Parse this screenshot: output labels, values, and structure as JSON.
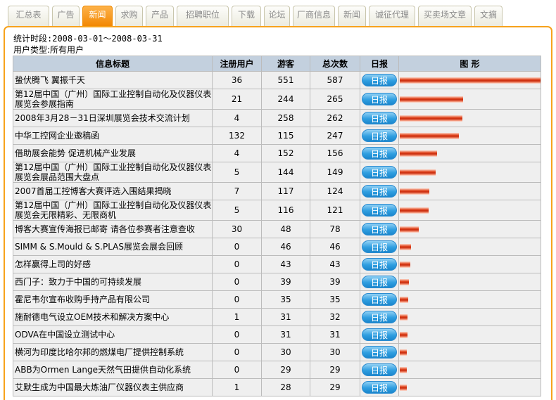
{
  "tabs": [
    {
      "label": "汇总表",
      "active": false
    },
    {
      "label": "广告",
      "active": false
    },
    {
      "label": "新闻",
      "active": true
    },
    {
      "label": "求购",
      "active": false
    },
    {
      "label": "产品",
      "active": false
    },
    {
      "label": "招聘职位",
      "active": false
    },
    {
      "label": "下载",
      "active": false
    },
    {
      "label": "论坛",
      "active": false
    },
    {
      "label": "厂商信息",
      "active": false
    },
    {
      "label": "新闻",
      "active": false
    },
    {
      "label": "诚征代理",
      "active": false
    },
    {
      "label": "买卖场文章",
      "active": false
    },
    {
      "label": "文摘",
      "active": false
    }
  ],
  "meta": {
    "period": "统计时段:2008-03-01～2008-03-31",
    "user_type": "用户类型:所有用户"
  },
  "table": {
    "headers": {
      "title": "信息标题",
      "registered": "注册用户",
      "guests": "游客",
      "total": "总次数",
      "daily": "日报",
      "graph": "图 形"
    },
    "daily_label": "日报",
    "max_total": 587,
    "rows": [
      {
        "title": "蛰伏腾飞 翼振千天",
        "registered": "36",
        "guests": "551",
        "total": "587",
        "value": 587
      },
      {
        "title": "第12届中国（广州）国际工业控制自动化及仪器仪表展览会参展指南",
        "registered": "21",
        "guests": "244",
        "total": "265",
        "value": 265
      },
      {
        "title": "2008年3月28－31日深圳展览会技术交流计划",
        "registered": "4",
        "guests": "258",
        "total": "262",
        "value": 262
      },
      {
        "title": "中华工控网企业邀稿函",
        "registered": "132",
        "guests": "115",
        "total": "247",
        "value": 247
      },
      {
        "title": "借助展会能势 促进机械产业发展",
        "registered": "4",
        "guests": "152",
        "total": "156",
        "value": 156
      },
      {
        "title": "第12届中国（广州）国际工业控制自动化及仪器仪表展览会展品范围大盘点",
        "registered": "5",
        "guests": "144",
        "total": "149",
        "value": 149
      },
      {
        "title": "2007首届工控博客大赛评选入围结果揭晓",
        "registered": "7",
        "guests": "117",
        "total": "124",
        "value": 124
      },
      {
        "title": "第12届中国（广州）国际工业控制自动化及仪器仪表展览会无限精彩、无限商机",
        "registered": "5",
        "guests": "116",
        "total": "121",
        "value": 121
      },
      {
        "title": "博客大赛宣传海报已邮寄 请各位参赛者注意查收",
        "registered": "30",
        "guests": "48",
        "total": "78",
        "value": 78
      },
      {
        "title": "SIMM & S.Mould & S.PLAS展览会展会回顾",
        "registered": "0",
        "guests": "46",
        "total": "46",
        "value": 46
      },
      {
        "title": "怎样赢得上司的好感",
        "registered": "0",
        "guests": "43",
        "total": "43",
        "value": 43
      },
      {
        "title": "西门子：致力于中国的可持续发展",
        "registered": "0",
        "guests": "39",
        "total": "39",
        "value": 39
      },
      {
        "title": "霍尼韦尔宣布收购手持产品有限公司",
        "registered": "0",
        "guests": "35",
        "total": "35",
        "value": 35
      },
      {
        "title": "施耐德电气设立OEM技术和解决方案中心",
        "registered": "1",
        "guests": "31",
        "total": "32",
        "value": 32
      },
      {
        "title": "ODVA在中国设立测试中心",
        "registered": "0",
        "guests": "31",
        "total": "31",
        "value": 31
      },
      {
        "title": "横河为印度比哈尔邦的燃煤电厂提供控制系统",
        "registered": "0",
        "guests": "30",
        "total": "30",
        "value": 30
      },
      {
        "title": "ABB为Ormen Lange天然气田提供自动化系统",
        "registered": "0",
        "guests": "29",
        "total": "29",
        "value": 29
      },
      {
        "title": "艾默生成为中国最大炼油厂仪器仪表主供应商",
        "registered": "1",
        "guests": "28",
        "total": "29",
        "value": 29
      }
    ]
  }
}
